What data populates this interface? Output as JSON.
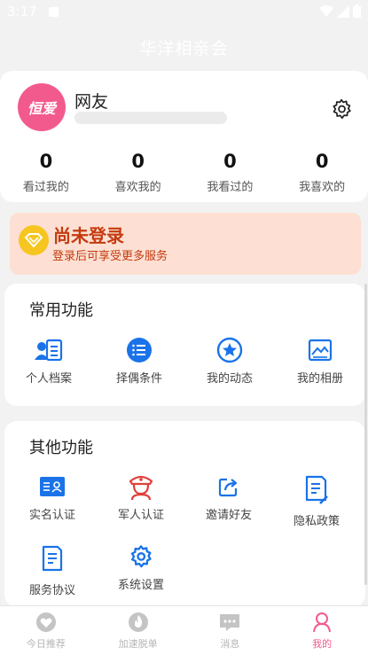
{
  "status_bar": {
    "time": "3:17"
  },
  "header": {
    "title": "华洋相亲会"
  },
  "profile": {
    "avatar_text": "恒爱",
    "name": "网友",
    "stats": [
      {
        "value": "0",
        "label": "看过我的"
      },
      {
        "value": "0",
        "label": "喜欢我的"
      },
      {
        "value": "0",
        "label": "我看过的"
      },
      {
        "value": "0",
        "label": "我喜欢的"
      }
    ]
  },
  "login_banner": {
    "title": "尚未登录",
    "subtitle": "登录后可享受更多服务"
  },
  "common_functions": {
    "title": "常用功能",
    "items": [
      {
        "label": "个人档案",
        "icon": "profile-card-icon"
      },
      {
        "label": "择偶条件",
        "icon": "list-icon"
      },
      {
        "label": "我的动态",
        "icon": "star-icon"
      },
      {
        "label": "我的相册",
        "icon": "photo-icon"
      }
    ]
  },
  "other_functions": {
    "title": "其他功能",
    "items": [
      {
        "label": "实名认证",
        "icon": "id-card-icon"
      },
      {
        "label": "军人认证",
        "icon": "soldier-icon"
      },
      {
        "label": "邀请好友",
        "icon": "share-icon"
      },
      {
        "label": "隐私政策",
        "icon": "document-edit-icon"
      },
      {
        "label": "服务协议",
        "icon": "document-icon"
      },
      {
        "label": "系统设置",
        "icon": "settings-icon"
      }
    ]
  },
  "tabbar": {
    "tabs": [
      {
        "label": "今日推荐",
        "icon": "heart-icon",
        "active": false
      },
      {
        "label": "加速脱单",
        "icon": "fire-icon",
        "active": false
      },
      {
        "label": "消息",
        "icon": "message-icon",
        "active": false
      },
      {
        "label": "我的",
        "icon": "person-icon",
        "active": true
      }
    ]
  },
  "colors": {
    "brand": "#f25a8e",
    "accent_blue": "#1a73e8",
    "login_bg": "#fde0d3",
    "login_text": "#c43a0f"
  }
}
